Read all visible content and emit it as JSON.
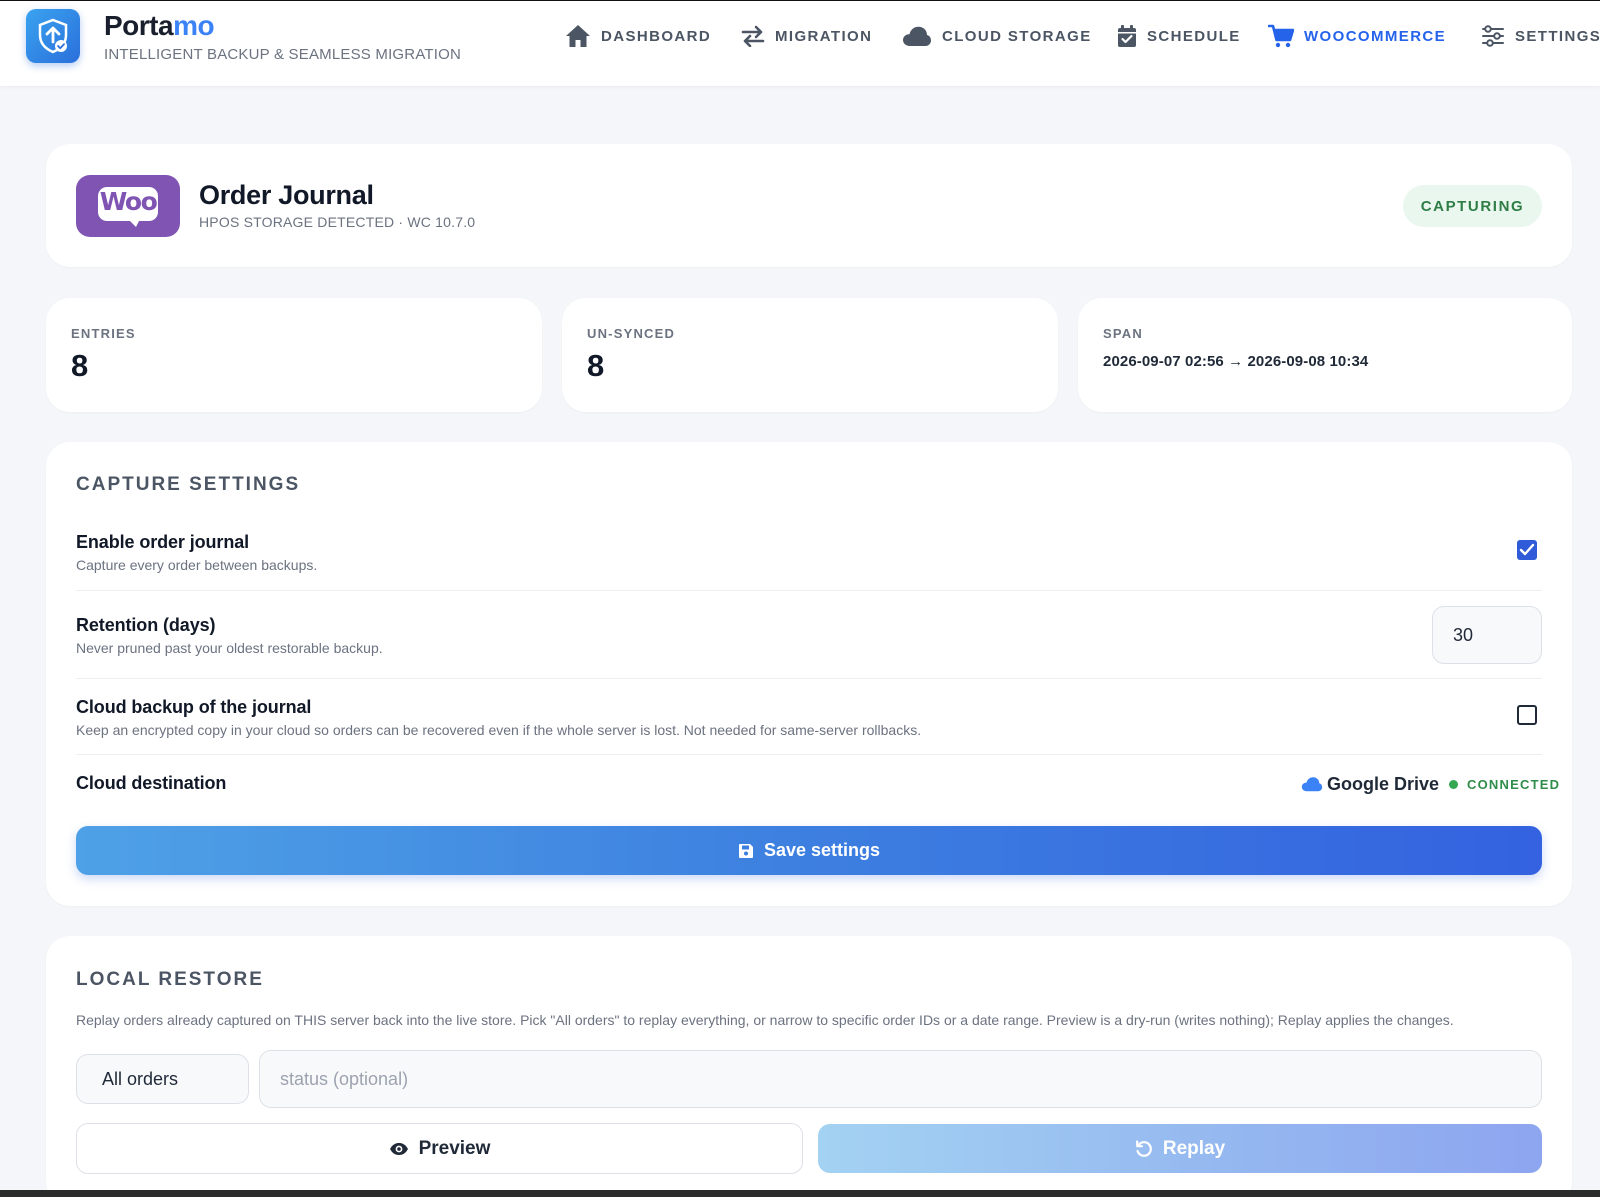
{
  "header": {
    "brand_prefix": "Porta",
    "brand_suffix": "mo",
    "tagline": "INTELLIGENT BACKUP & SEAMLESS MIGRATION",
    "logo_icon": "shield-upload-icon",
    "nav": [
      {
        "label": "DASHBOARD",
        "icon": "home-icon",
        "active": false
      },
      {
        "label": "MIGRATION",
        "icon": "swap-arrows-icon",
        "active": false
      },
      {
        "label": "CLOUD STORAGE",
        "icon": "cloud-icon",
        "active": false
      },
      {
        "label": "SCHEDULE",
        "icon": "calendar-check-icon",
        "active": false
      },
      {
        "label": "WOOCOMMERCE",
        "icon": "cart-icon",
        "active": true
      },
      {
        "label": "SETTINGS",
        "icon": "sliders-icon",
        "active": false
      }
    ]
  },
  "journal": {
    "logo_text": "Woo",
    "title": "Order Journal",
    "subtitle": "HPOS STORAGE DETECTED · WC 10.7.0",
    "status_badge": "CAPTURING"
  },
  "stats": {
    "entries_label": "ENTRIES",
    "entries_value": "8",
    "unsynced_label": "UN-SYNCED",
    "unsynced_value": "8",
    "span_label": "SPAN",
    "span_value": "2026-09-07 02:56 → 2026-09-08 10:34"
  },
  "capture_settings": {
    "title": "CAPTURE SETTINGS",
    "enable": {
      "label": "Enable order journal",
      "description": "Capture every order between backups.",
      "checked": true
    },
    "retention": {
      "label": "Retention (days)",
      "description": "Never pruned past your oldest restorable backup.",
      "value": "30"
    },
    "cloud_backup": {
      "label": "Cloud backup of the journal",
      "description": "Keep an encrypted copy in your cloud so orders can be recovered even if the whole server is lost. Not needed for same-server rollbacks.",
      "checked": false
    },
    "cloud_destination": {
      "label": "Cloud destination",
      "provider": "Google Drive",
      "status": "CONNECTED"
    },
    "save_label": "Save settings"
  },
  "local_restore": {
    "title": "LOCAL RESTORE",
    "description": "Replay orders already captured on THIS server back into the live store. Pick \"All orders\" to replay everything, or narrow to specific order IDs or a date range. Preview is a dry-run (writes nothing); Replay applies the changes.",
    "scope_selected": "All orders",
    "status_placeholder": "status (optional)",
    "preview_label": "Preview",
    "replay_label": "Replay"
  },
  "colors": {
    "accent": "#2563eb",
    "woo_purple": "#7f54b3",
    "success": "#2f7d46"
  }
}
